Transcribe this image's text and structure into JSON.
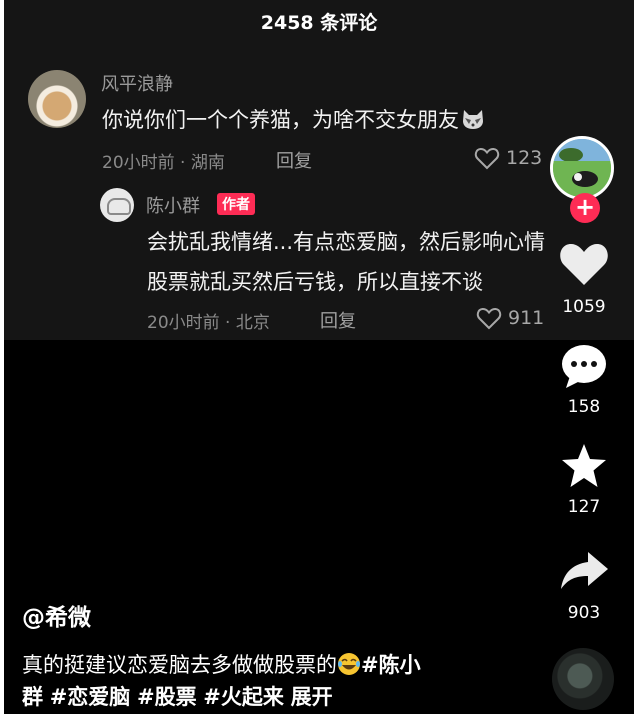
{
  "header": {
    "comment_count_title": "2458 条评论"
  },
  "comments": [
    {
      "username": "风平浪静",
      "text": "你说你们一个个养猫，为啥不交女朋友",
      "emoji": "cat-face-emoji",
      "meta": "20小时前 · 湖南",
      "reply_label": "回复",
      "likes": "123"
    },
    {
      "username": "陈小群",
      "badge": "作者",
      "text_lines": [
        "会扰乱我情绪...有点恋爱脑，然后影响心情",
        "股票就乱买然后亏钱，所以直接不谈"
      ],
      "meta": "20小时前 · 北京",
      "reply_label": "回复",
      "likes": "911"
    }
  ],
  "rail": {
    "likes": "1059",
    "comments": "158",
    "favorites": "127",
    "shares": "903",
    "follow_icon": "plus-icon"
  },
  "video": {
    "author_handle": "@希微",
    "caption_text": "真的挺建议恋爱脑去多做做股票的",
    "caption_emoji": "laughing-tears-emoji",
    "hashtags": [
      "#陈小",
      "群",
      "#恋爱脑",
      "#股票",
      "#火起来"
    ],
    "expand_label": "展开"
  },
  "colors": {
    "badge_red": "#fe2c55",
    "panel_bg": "#151515",
    "muted_text": "#8a8a8a"
  }
}
